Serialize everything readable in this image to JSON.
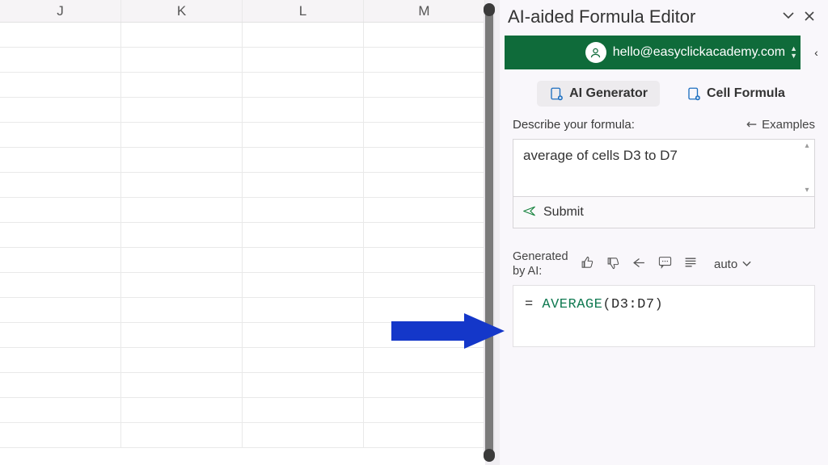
{
  "grid": {
    "columns": [
      "J",
      "K",
      "L",
      "M"
    ],
    "row_count": 17
  },
  "panel": {
    "title": "AI-aided Formula Editor",
    "account_email": "hello@easyclickacademy.com",
    "tabs": {
      "ai_generator": "AI Generator",
      "cell_formula": "Cell Formula"
    },
    "describe_label": "Describe your formula:",
    "examples_label": "Examples",
    "description_value": "average of cells D3 to D7",
    "submit_label": "Submit",
    "generated_label_line1": "Generated",
    "generated_label_line2": "by AI:",
    "auto_label": "auto",
    "formula": {
      "equals": "=",
      "function": "AVERAGE",
      "open": "(",
      "arg": "D3:D7",
      "close": ")"
    }
  }
}
